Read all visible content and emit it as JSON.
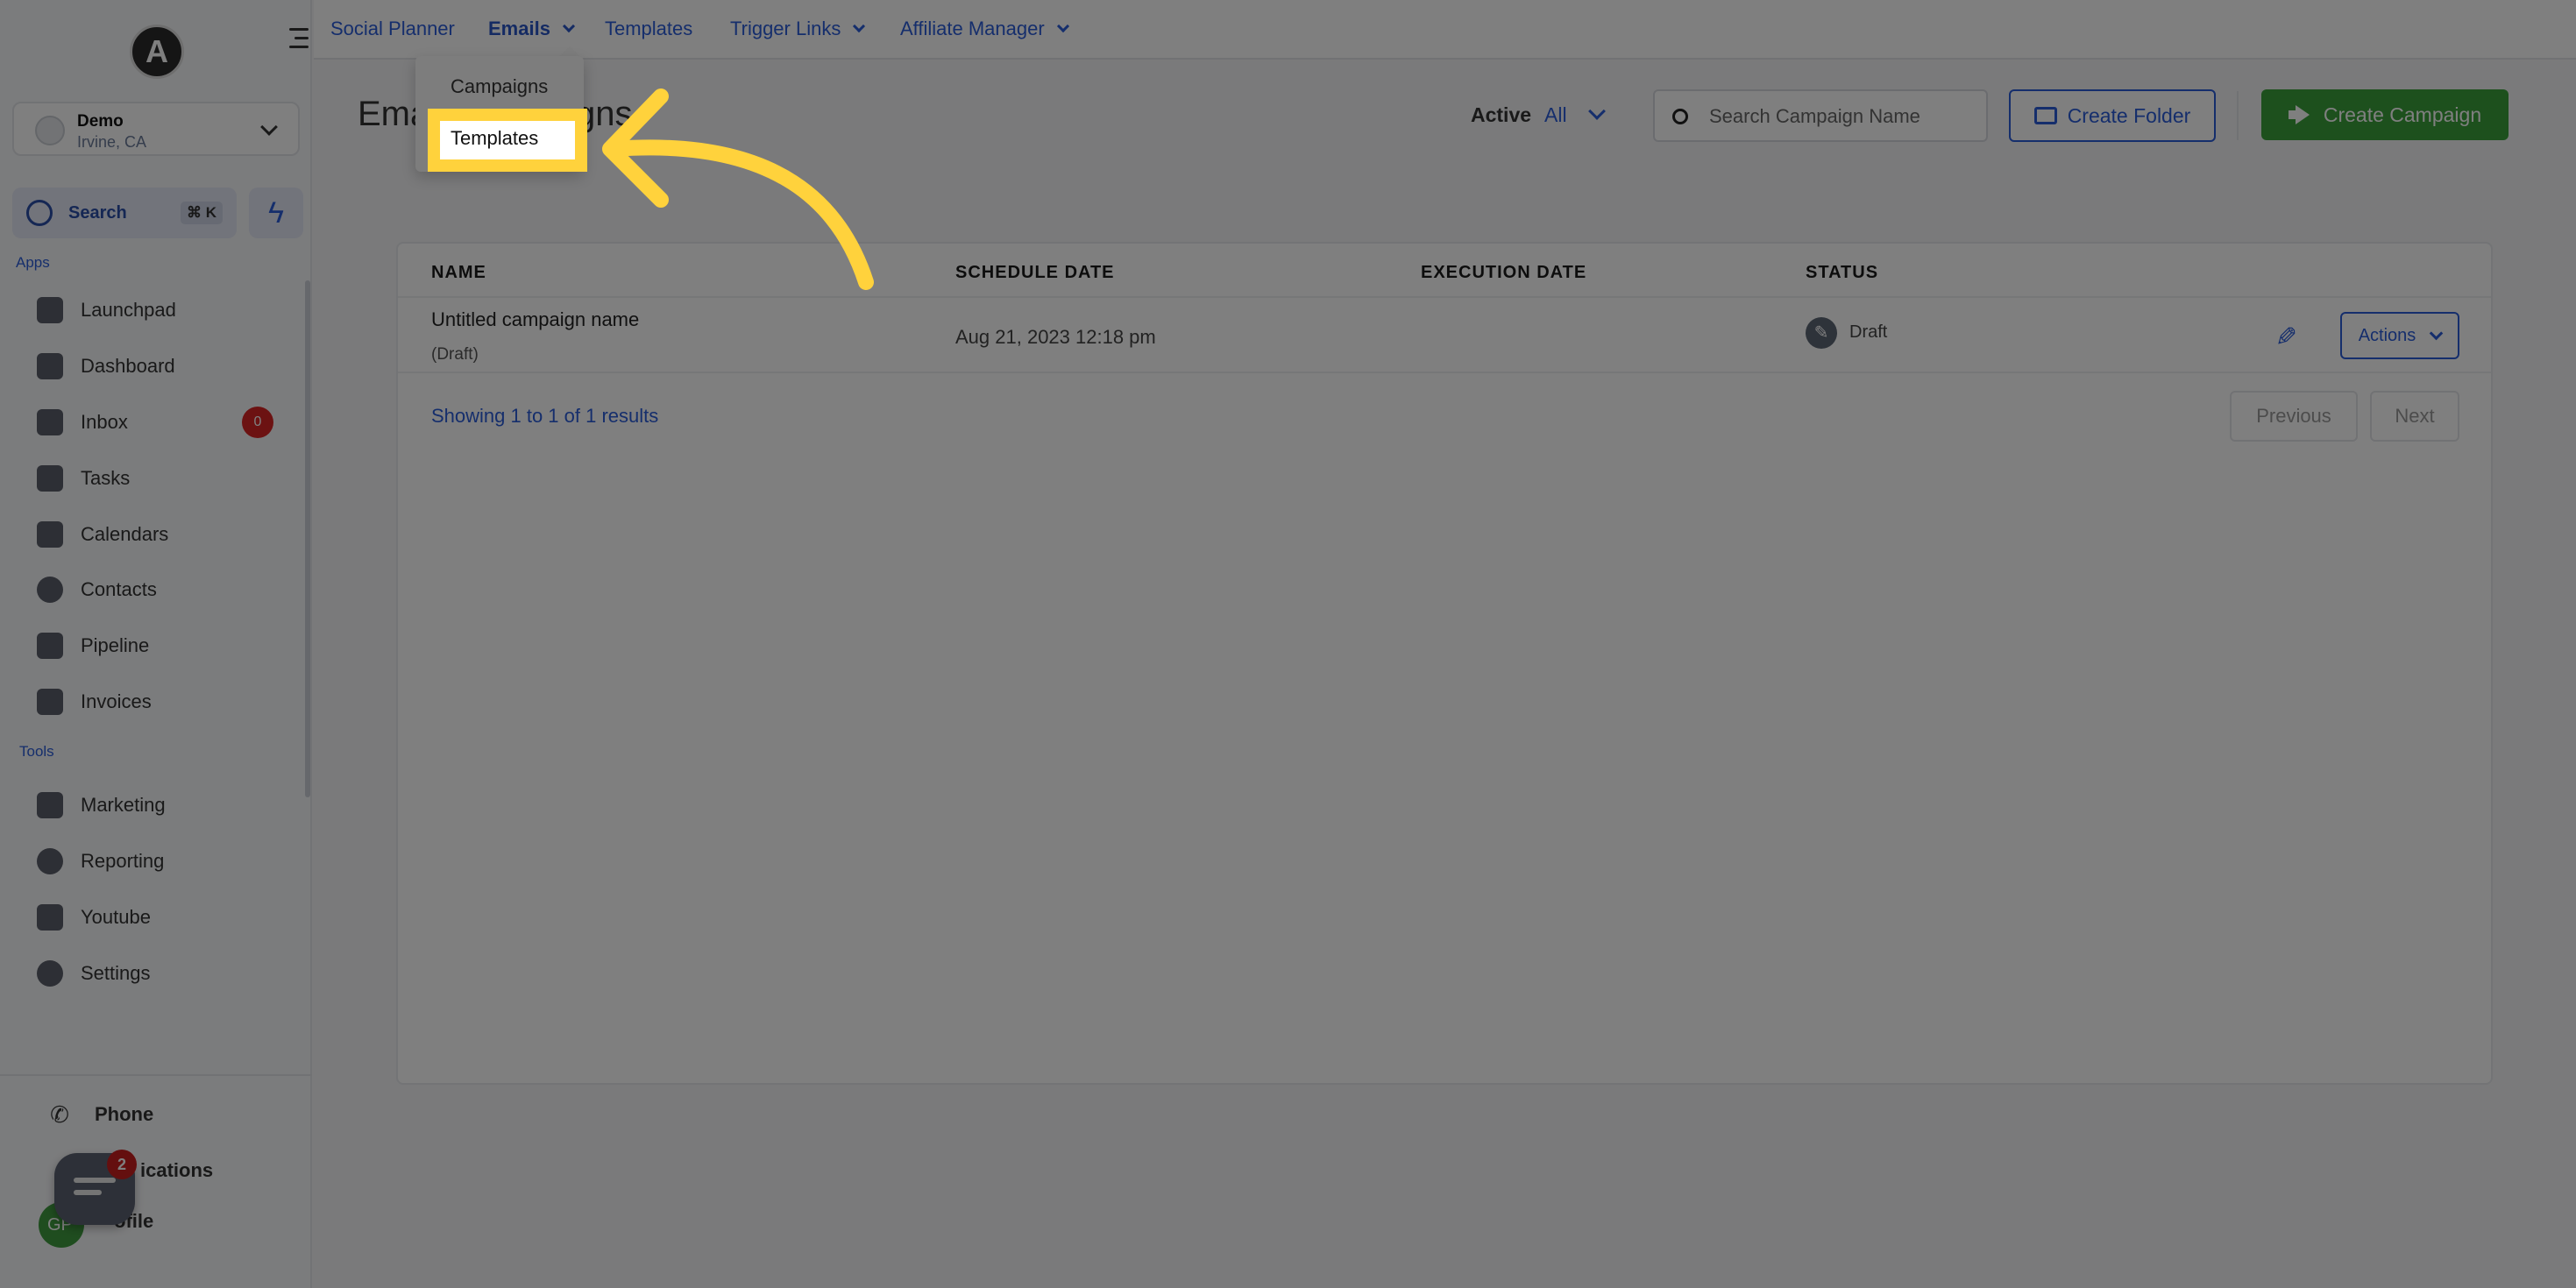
{
  "sidebar": {
    "logo_letter": "A",
    "account": {
      "name": "Demo",
      "location": "Irvine, CA"
    },
    "search": {
      "label": "Search",
      "shortcut": "⌘ K"
    },
    "apps_label": "Apps",
    "tools_label": "Tools",
    "apps": [
      {
        "label": "Launchpad",
        "icon": "rocket-icon"
      },
      {
        "label": "Dashboard",
        "icon": "grid-icon"
      },
      {
        "label": "Inbox",
        "icon": "inbox-icon",
        "badge": "0"
      },
      {
        "label": "Tasks",
        "icon": "clipboard-icon"
      },
      {
        "label": "Calendars",
        "icon": "calendar-icon"
      },
      {
        "label": "Contacts",
        "icon": "person-icon"
      },
      {
        "label": "Pipeline",
        "icon": "filter-icon"
      },
      {
        "label": "Invoices",
        "icon": "receipt-icon"
      }
    ],
    "tools": [
      {
        "label": "Marketing",
        "icon": "megaphone-icon"
      },
      {
        "label": "Reporting",
        "icon": "pie-chart-icon"
      },
      {
        "label": "Youtube",
        "icon": "youtube-icon"
      },
      {
        "label": "Settings",
        "icon": "gear-icon"
      }
    ],
    "bottom": {
      "phone": "Phone",
      "notifications": "ications",
      "profile": "ofile",
      "chat_badge": "2",
      "avatar_initials": "GP"
    }
  },
  "topnav": {
    "items": [
      {
        "label": "Social Planner",
        "dropdown": false
      },
      {
        "label": "Emails",
        "dropdown": true,
        "active": true
      },
      {
        "label": "Templates",
        "dropdown": false
      },
      {
        "label": "Trigger Links",
        "dropdown": true
      },
      {
        "label": "Affiliate Manager",
        "dropdown": true
      }
    ]
  },
  "dropdown": {
    "items": [
      "Campaigns",
      "Templates"
    ],
    "highlighted": "Templates"
  },
  "page": {
    "title": "Email Campaigns",
    "filter_label": "Active",
    "filter_value": "All",
    "search_placeholder": "Search Campaign Name",
    "create_folder": "Create Folder",
    "create_campaign": "Create Campaign"
  },
  "table": {
    "columns": [
      "NAME",
      "SCHEDULE DATE",
      "EXECUTION DATE",
      "STATUS"
    ],
    "rows": [
      {
        "name": "Untitled campaign name",
        "sub": "(Draft)",
        "schedule_date": "Aug 21, 2023 12:18 pm",
        "execution_date": "",
        "status": "Draft",
        "actions": "Actions"
      }
    ],
    "showing": "Showing 1 to 1 of 1 results",
    "prev": "Previous",
    "next": "Next"
  },
  "colors": {
    "accent": "#2b5cd9",
    "primary_button": "#3aa13a",
    "highlight": "#ffd23c",
    "badge": "#d92525"
  }
}
